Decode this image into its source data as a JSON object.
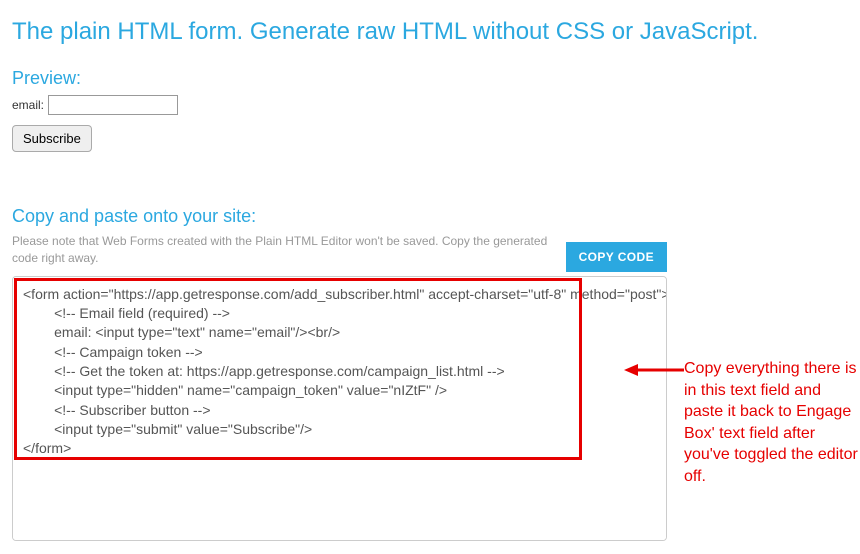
{
  "title": "The plain HTML form. Generate raw HTML without CSS or JavaScript.",
  "preview": {
    "heading": "Preview:",
    "email_label": "email:",
    "email_value": "",
    "subscribe_label": "Subscribe"
  },
  "copy_section": {
    "heading": "Copy and paste onto your site:",
    "note": "Please note that Web Forms created with the Plain HTML Editor won't be saved. Copy the generated code right away.",
    "copy_button": "COPY CODE",
    "code": "<form action=\"https://app.getresponse.com/add_subscriber.html\" accept-charset=\"utf-8\" method=\"post\">\n        <!-- Email field (required) -->\n        email: <input type=\"text\" name=\"email\"/><br/>\n        <!-- Campaign token -->\n        <!-- Get the token at: https://app.getresponse.com/campaign_list.html -->\n        <input type=\"hidden\" name=\"campaign_token\" value=\"nIZtF\" />\n        <!-- Subscriber button -->\n        <input type=\"submit\" value=\"Subscribe\"/>\n</form>"
  },
  "annotation": {
    "text": "Copy everything there is in this text field and paste it back to Engage Box' text field after you've toggled the editor off."
  }
}
